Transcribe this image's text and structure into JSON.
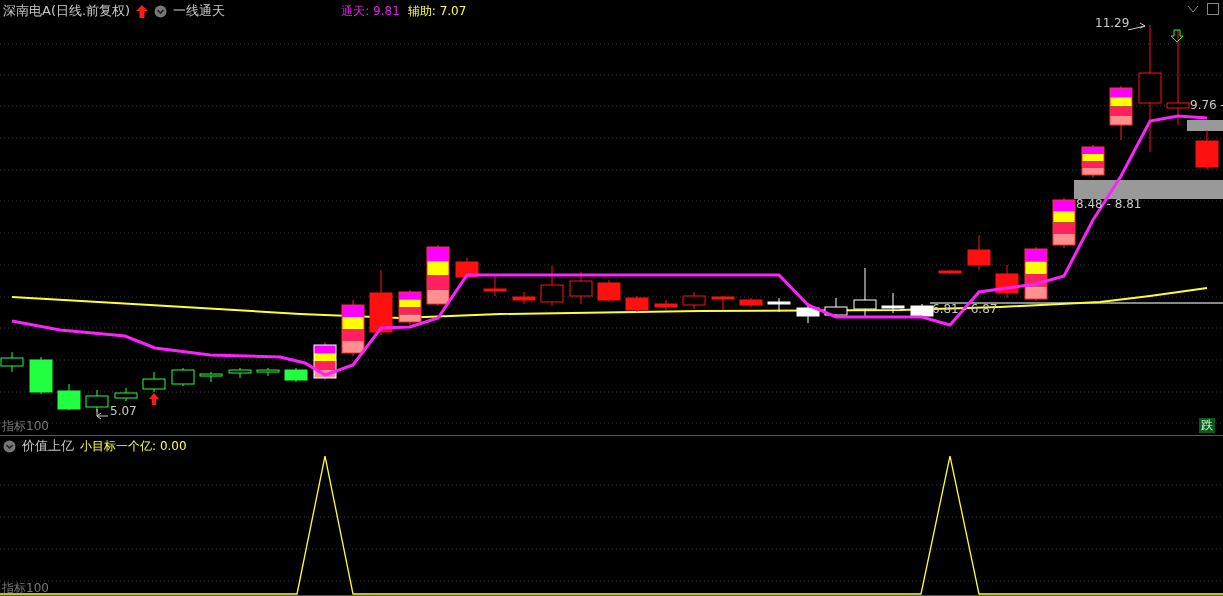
{
  "header": {
    "title": "深南电A(日线.前复权)",
    "indicator_name": "一线通天",
    "legend": [
      {
        "label": "通天:",
        "value": "9.81",
        "color": "#e020e0"
      },
      {
        "label": "辅助:",
        "value": "7.07",
        "color": "#ffff40"
      }
    ]
  },
  "main_panel": {
    "price_labels": [
      {
        "text": "11.29"
      },
      {
        "text": "9.76 -"
      },
      {
        "text": "8.48 - 8.81"
      },
      {
        "text": "6.81 - 6.87"
      },
      {
        "text": "5.07"
      }
    ],
    "scale_label": "指标100",
    "signal_badge": "跌"
  },
  "sub_panel": {
    "indicator_name": "价值上亿",
    "legend": [
      {
        "label": "小目标一个亿:",
        "value": "0.00",
        "color": "#ffff40"
      }
    ],
    "scale_label": "指标100"
  }
}
